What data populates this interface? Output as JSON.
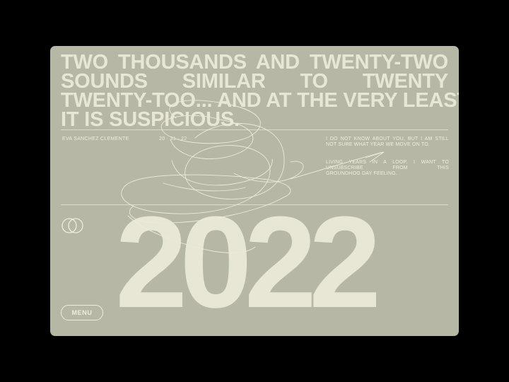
{
  "headline": {
    "line1": "TWO THOUSANDS AND TWENTY-TWO",
    "line2": "SOUNDS SIMILAR TO TWENTY",
    "line3": "TWENTY-TOO... AND AT THE VERY LEAST",
    "line4": "IT IS SUSPICIOUS."
  },
  "meta": {
    "author": "EVA SANCHEZ CLEMENTE",
    "date": "20 · 31 · 22"
  },
  "text": {
    "para1": "I DO NOT KNOW ABOUT YOU, BUT I AM STILL NOT SURE WHAT YEAR WE MOVE ON TO.",
    "para2_line1": "LIVING YEARS IN A LOOP. I WANT TO UNSUBSCRIBE FROM THIS",
    "para2_line2": "GROUNDHOG DAY FEELING."
  },
  "year": "2022",
  "menu": {
    "label": "MENU"
  },
  "icons": {
    "logo": "interlocking-rings-icon",
    "decor": "scribble-loop"
  },
  "colors": {
    "background": "#000000",
    "card": "#b6b7a5",
    "text": "#e8e6d5"
  }
}
